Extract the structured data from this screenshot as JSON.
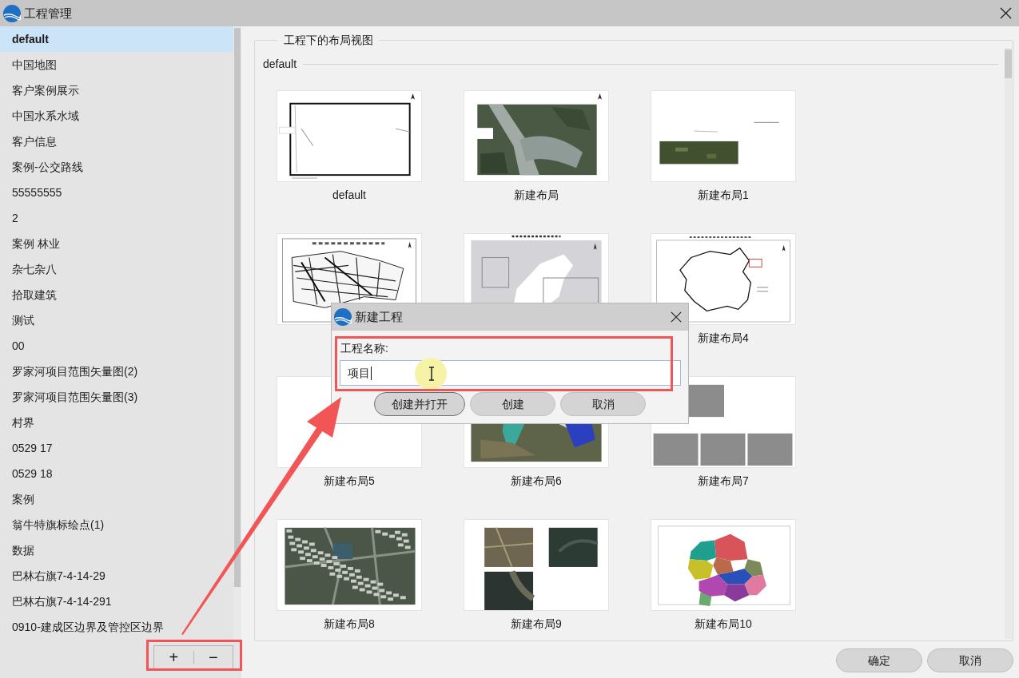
{
  "window": {
    "title": "工程管理"
  },
  "sidebar": {
    "items": [
      {
        "label": "default",
        "selected": true
      },
      {
        "label": "中国地图",
        "selected": false
      },
      {
        "label": "客户案例展示",
        "selected": false
      },
      {
        "label": "中国水系水域",
        "selected": false
      },
      {
        "label": "客户信息",
        "selected": false
      },
      {
        "label": "案例-公交路线",
        "selected": false
      },
      {
        "label": "55555555",
        "selected": false
      },
      {
        "label": "2",
        "selected": false
      },
      {
        "label": "案例 林业",
        "selected": false
      },
      {
        "label": "杂七杂八",
        "selected": false
      },
      {
        "label": "拾取建筑",
        "selected": false
      },
      {
        "label": "测试",
        "selected": false
      },
      {
        "label": "00",
        "selected": false
      },
      {
        "label": "罗家河项目范围矢量图(2)",
        "selected": false
      },
      {
        "label": "罗家河项目范围矢量图(3)",
        "selected": false
      },
      {
        "label": "村界",
        "selected": false
      },
      {
        "label": "0529 17",
        "selected": false
      },
      {
        "label": "0529 18",
        "selected": false
      },
      {
        "label": "案例",
        "selected": false
      },
      {
        "label": "翁牛特旗标绘点(1)",
        "selected": false
      },
      {
        "label": "数据",
        "selected": false
      },
      {
        "label": "巴林右旗7-4-14-29",
        "selected": false
      },
      {
        "label": "巴林右旗7-4-14-291",
        "selected": false
      },
      {
        "label": "0910-建成区边界及管控区边界",
        "selected": false
      }
    ],
    "buttons": [
      "+",
      "−"
    ]
  },
  "layout_view": {
    "title": "工程下的布局视图",
    "section": "default",
    "layouts": [
      {
        "label": "default",
        "kind": "frame"
      },
      {
        "label": "新建布局",
        "kind": "satellite"
      },
      {
        "label": "新建布局1",
        "kind": "strip"
      },
      {
        "kind": "street"
      },
      {
        "kind": "region"
      },
      {
        "label": "新建布局4",
        "kind": "outline"
      },
      {
        "label": "新建布局5",
        "kind": "blank"
      },
      {
        "label": "新建布局6",
        "kind": "patches"
      },
      {
        "label": "新建布局7",
        "kind": "blocks"
      },
      {
        "label": "新建布局8",
        "kind": "aerial"
      },
      {
        "label": "新建布局9",
        "kind": "tiles"
      },
      {
        "label": "新建布局10",
        "kind": "choropleth"
      }
    ]
  },
  "buttons": [
    "确定",
    "取消"
  ],
  "dialog": {
    "title": "新建工程",
    "field_label": "工程名称:",
    "field_value": "项目",
    "buttons": [
      {
        "label": "创建并打开",
        "focused": true
      },
      {
        "label": "创建",
        "focused": false
      },
      {
        "label": "取消",
        "focused": false
      }
    ]
  }
}
